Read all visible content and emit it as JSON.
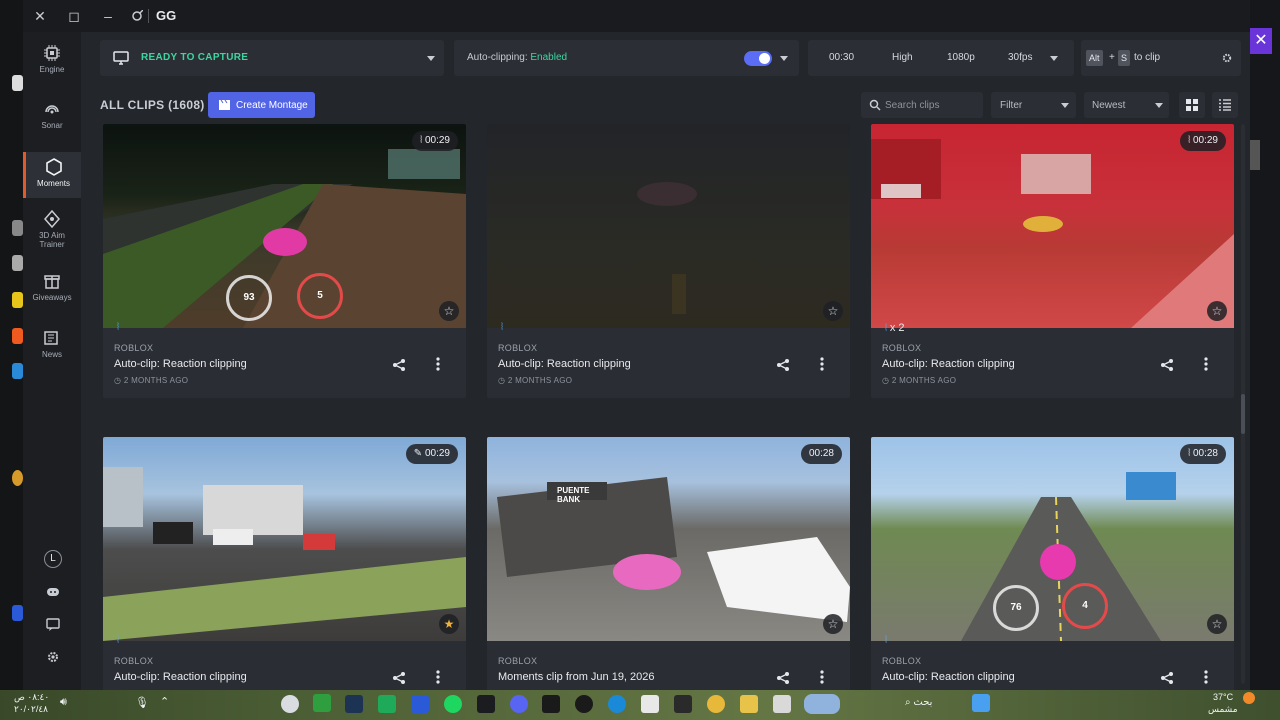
{
  "window": {
    "title": "GG"
  },
  "sidebar": {
    "items": [
      {
        "label": "Engine",
        "icon": "chip-icon"
      },
      {
        "label": "Sonar",
        "icon": "sonar-icon"
      },
      {
        "label": "Moments",
        "icon": "hexagon-icon"
      },
      {
        "label": "3D Aim Trainer",
        "icon": "crosshair-icon"
      },
      {
        "label": "Giveaways",
        "icon": "gift-icon"
      },
      {
        "label": "News",
        "icon": "newspaper-icon"
      }
    ],
    "active": "Moments",
    "avatar": "L"
  },
  "topbar": {
    "capture_status": "READY TO CAPTURE",
    "autoclip_label": "Auto-clipping:",
    "autoclip_state": "Enabled",
    "duration": "00:30",
    "quality": "High",
    "resolution": "1080p",
    "fps": "30fps",
    "hotkey_1": "Alt",
    "hotkey_plus": "+",
    "hotkey_2": "S",
    "hotkey_suffix": "to clip"
  },
  "clips": {
    "header": "ALL CLIPS (1608)",
    "montage_button": "Create Montage",
    "search_placeholder": "Search clips",
    "filter_label": "Filter",
    "sort_label": "Newest",
    "items": [
      {
        "game": "ROBLOX",
        "title": "Auto-clip: Reaction clipping",
        "age": "2 MONTHS AGO",
        "duration": "00:29",
        "speed": "93",
        "gear": "5"
      },
      {
        "game": "ROBLOX",
        "title": "Auto-clip: Reaction clipping",
        "age": "2 MONTHS AGO",
        "duration": ""
      },
      {
        "game": "ROBLOX",
        "title": "Auto-clip: Reaction clipping",
        "age": "2 MONTHS AGO",
        "duration": "00:29",
        "badge": "x 2"
      },
      {
        "game": "ROBLOX",
        "title": "Auto-clip: Reaction clipping",
        "age": "",
        "duration": "00:29"
      },
      {
        "game": "ROBLOX",
        "title": "Moments clip from Jun 19, 2026",
        "age": "",
        "duration": "00:28",
        "sign": "PUENTE BANK"
      },
      {
        "game": "ROBLOX",
        "title": "Auto-clip: Reaction clipping",
        "age": "",
        "duration": "00:28",
        "speed": "76",
        "gear": "4"
      }
    ]
  },
  "taskbar": {
    "time": "٠٨:٤٠ ص",
    "date": "٢٠/٠٢/٤٨",
    "search": "بحث",
    "temperature": "37°C",
    "weather": "مشمس"
  },
  "colors": {
    "accent": "#5264e6",
    "status_green": "#3ed6a0",
    "active_marker": "#e05a2a"
  }
}
